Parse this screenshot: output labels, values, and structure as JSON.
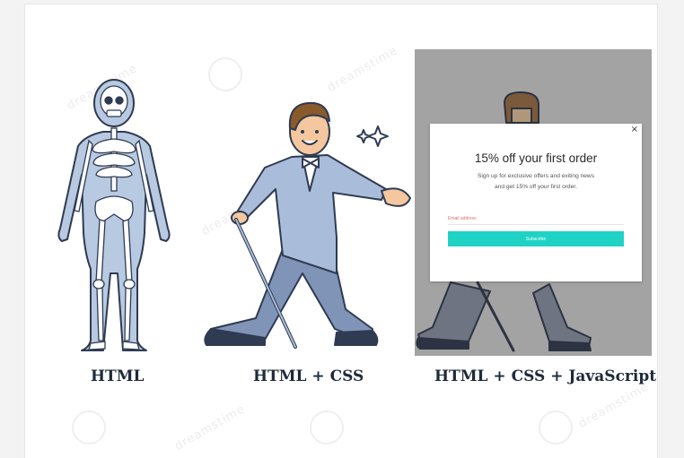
{
  "labels": {
    "html": "HTML",
    "html_css": "HTML + CSS",
    "html_css_js": "HTML + CSS + JavaScript"
  },
  "popup": {
    "close": "×",
    "title": "15% off your first order",
    "text_line1": "Sign up for exclusive offers and exiting news",
    "text_line2": "and get 15% off your first order.",
    "email_placeholder": "Email address",
    "subscribe_label": "Subscribe"
  },
  "watermark": {
    "text": "dreamstime"
  },
  "colors": {
    "skeleton_body": "#b8c9e2",
    "bone": "#ffffff",
    "outline": "#2f3b52",
    "suit": "#a9bcd9",
    "pants": "#8094b7",
    "skin": "#f4c79e",
    "hair": "#8a5a2b",
    "overlay": "#a3a3a3",
    "subscribe_button": "#1ed3c6"
  }
}
